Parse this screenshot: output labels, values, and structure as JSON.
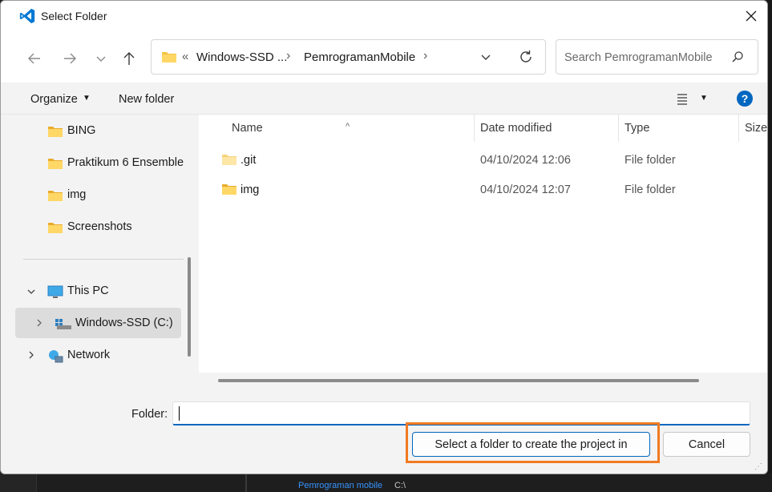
{
  "window": {
    "title": "Select Folder",
    "close_label": "✕"
  },
  "nav": {
    "back_icon": "arrow-left-icon",
    "forward_icon": "arrow-right-icon",
    "recent_icon": "chevron-down-icon",
    "up_icon": "arrow-up-icon"
  },
  "address": {
    "overflow": "«",
    "segments": [
      "Windows-SSD ...",
      "PemrogramanMobile"
    ],
    "separator": "›"
  },
  "search": {
    "placeholder": "Search PemrogramanMobile"
  },
  "toolbar": {
    "organize": "Organize",
    "new_folder": "New folder",
    "help": "?"
  },
  "navpane": {
    "folders": [
      "BING",
      "Praktikum 6 Ensemble",
      "img",
      "Screenshots"
    ],
    "this_pc": "This PC",
    "drive": "Windows-SSD (C:)",
    "network": "Network"
  },
  "columns": {
    "name": "Name",
    "date": "Date modified",
    "type": "Type",
    "size": "Size"
  },
  "files": [
    {
      "name": ".git",
      "date": "04/10/2024 12:06",
      "type": "File folder"
    },
    {
      "name": "img",
      "date": "04/10/2024 12:07",
      "type": "File folder"
    }
  ],
  "footer": {
    "folder_label": "Folder:",
    "folder_value": "",
    "select_button": "Select a folder to create the project in",
    "cancel_button": "Cancel"
  },
  "background": {
    "crumb": "Pemrograman mobile",
    "path": "C:\\"
  },
  "colors": {
    "accent": "#0067c0",
    "highlight": "#f07a22",
    "folder": "#f5c441"
  }
}
